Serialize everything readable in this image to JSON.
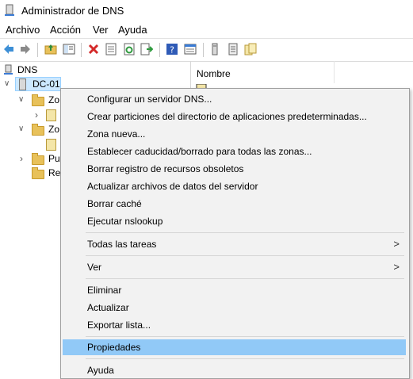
{
  "window": {
    "title": "Administrador de DNS"
  },
  "menubar": [
    "Archivo",
    "Acción",
    "Ver",
    "Ayuda"
  ],
  "toolbar": {
    "buttons": [
      "back-icon",
      "forward-icon",
      "up-folder-icon",
      "show-hide-tree-icon",
      "delete-icon",
      "properties-icon",
      "refresh-icon",
      "export-list-icon",
      "help-icon",
      "view-icon",
      "server-icon",
      "list-icon",
      "zone-icon"
    ]
  },
  "tree": {
    "root": "DNS",
    "server": "DC-01",
    "nodes": [
      "Zo",
      "Zo",
      "Pu",
      "Re"
    ]
  },
  "list": {
    "column_name": "Nombre"
  },
  "context_menu": {
    "items": [
      {
        "label": "Configurar un servidor DNS..."
      },
      {
        "label": "Crear particiones del directorio de aplicaciones predeterminadas..."
      },
      {
        "label": "Zona nueva..."
      },
      {
        "label": "Establecer caducidad/borrado para todas las zonas..."
      },
      {
        "label": "Borrar registro de recursos obsoletos"
      },
      {
        "label": "Actualizar archivos de datos del servidor"
      },
      {
        "label": "Borrar caché"
      },
      {
        "label": "Ejecutar nslookup"
      },
      {
        "label": "Todas las tareas",
        "submenu": ">"
      },
      {
        "label": "Ver",
        "submenu": ">"
      },
      {
        "label": "Eliminar"
      },
      {
        "label": "Actualizar"
      },
      {
        "label": "Exportar lista..."
      },
      {
        "label": "Propiedades",
        "highlighted": true
      },
      {
        "label": "Ayuda"
      }
    ]
  },
  "colors": {
    "highlight": "#91c9f7",
    "selection": "#cce8ff",
    "menu_bg": "#f2f2f2"
  }
}
